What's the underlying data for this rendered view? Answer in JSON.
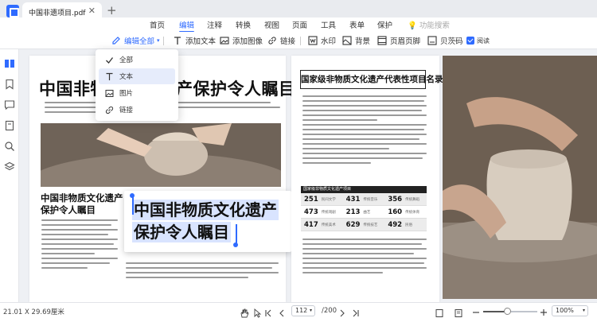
{
  "app": {
    "doc_tab_title": "中国非遗项目.pdf",
    "close_glyph": "✕",
    "new_tab_glyph": "+"
  },
  "menu": {
    "items": [
      "首页",
      "编辑",
      "注释",
      "转换",
      "视图",
      "页面",
      "工具",
      "表单",
      "保护"
    ],
    "active": "编辑",
    "search_label": "功能搜索"
  },
  "toolbar": {
    "edit_all": "编辑全部",
    "add_text": "添加文本",
    "add_image": "添加图像",
    "link": "链接",
    "watermark": "水印",
    "background": "背景",
    "header_footer": "页眉页脚",
    "bates": "贝茨码",
    "read_label": "阅读"
  },
  "dropdown": {
    "items": [
      {
        "label": "全部",
        "icon": "check-icon"
      },
      {
        "label": "文本",
        "icon": "text-icon"
      },
      {
        "label": "图片",
        "icon": "image-icon"
      },
      {
        "label": "链接",
        "icon": "link-icon"
      }
    ],
    "highlighted": "文本"
  },
  "document": {
    "left_title": "中国非物质文化遗产保护令人瞩目",
    "left_subtitle_1": "中国非物质文化遗产",
    "left_subtitle_2": "保护令人瞩目",
    "selected_line_1": "中国非物质文化遗产",
    "selected_line_2": "保护令人瞩目",
    "right_title": "国家级非物质文化遗产代表性项目名录",
    "stats": [
      {
        "a": "251",
        "al": "民间文学",
        "b": "431",
        "bl": "传统音乐",
        "c": "356",
        "cl": "传统舞蹈"
      },
      {
        "a": "473",
        "al": "传统戏剧",
        "b": "213",
        "bl": "曲艺",
        "c": "160",
        "cl": "传统体育"
      },
      {
        "a": "417",
        "al": "传统美术",
        "b": "629",
        "bl": "传统技艺",
        "c": "492",
        "cl": "民俗"
      }
    ],
    "stats_header": "国家级非物质文化遗产项目"
  },
  "status": {
    "page_size": "21.01 X 29.69厘米",
    "current_page": "112",
    "total_pages": "/200",
    "zoom": "100%",
    "zoom_fraction": 0.45
  },
  "colors": {
    "accent": "#2f6bff",
    "selection": "#d9e4ff"
  }
}
